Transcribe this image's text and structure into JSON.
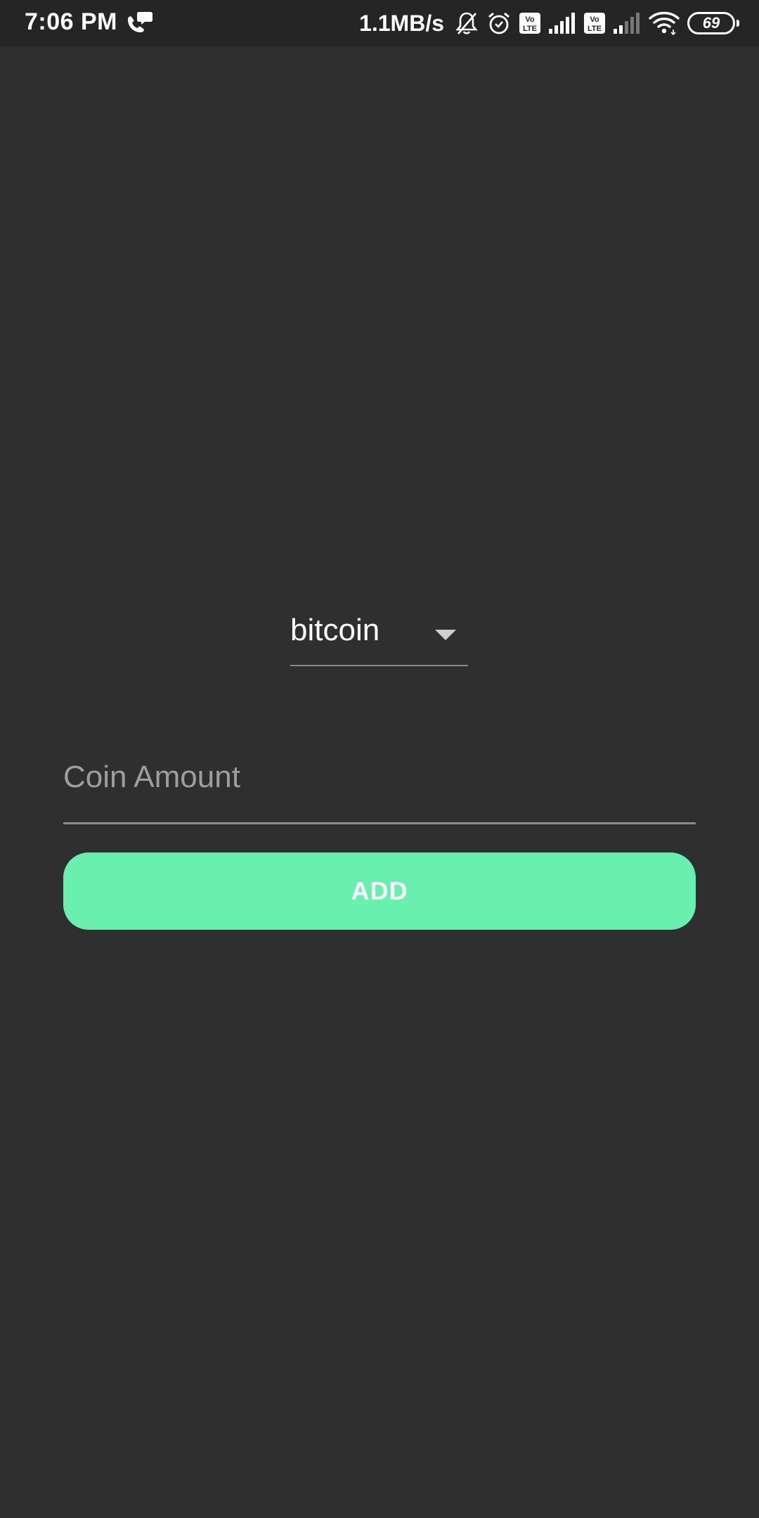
{
  "status_bar": {
    "time": "7:06 PM",
    "net_speed": "1.1MB/s",
    "battery_level": "69",
    "icons": [
      "chat-bubble-phone-icon",
      "mute-bell-icon",
      "alarm-icon",
      "volte-icon",
      "signal-icon",
      "volte-icon",
      "signal-weak-icon",
      "wifi-icon",
      "battery-icon"
    ]
  },
  "coin_select": {
    "selected": "bitcoin"
  },
  "amount_input": {
    "value": "",
    "placeholder": "Coin Amount"
  },
  "add_button": {
    "label": "ADD"
  },
  "colors": {
    "background": "#2f2f2f",
    "status_bar": "#252525",
    "accent": "#69f0ae"
  }
}
